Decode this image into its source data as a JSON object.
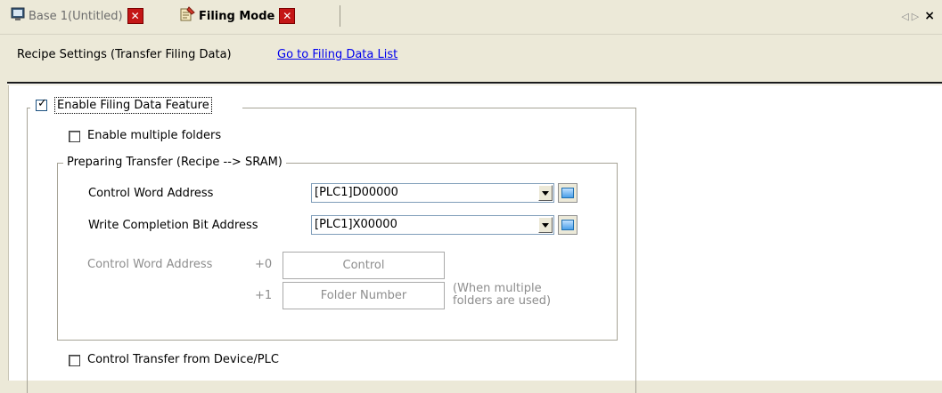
{
  "tabs": [
    {
      "label": "Base 1(Untitled)",
      "active": false,
      "icon": "monitor-icon"
    },
    {
      "label": "Filing Mode",
      "active": true,
      "icon": "filing-icon"
    }
  ],
  "nav": {
    "prev": "◁",
    "next": "▷",
    "close": "×"
  },
  "header": {
    "title": "Recipe Settings (Transfer Filing Data)",
    "link": "Go to Filing Data List"
  },
  "filing": {
    "enable_label": "Enable Filing Data Feature",
    "enable_checked": true,
    "multiple_folders_label": "Enable multiple folders",
    "multiple_folders_checked": false,
    "group_title": "Preparing Transfer (Recipe --> SRAM)",
    "control_word_label": "Control Word Address",
    "control_word_value": "[PLC1]D00000",
    "write_completion_label": "Write Completion Bit Address",
    "write_completion_value": "[PLC1]X00000",
    "table_title": "Control Word Address",
    "rows": [
      {
        "offset": "+0",
        "cell": "Control"
      },
      {
        "offset": "+1",
        "cell": "Folder Number"
      }
    ],
    "note_line1": "(When multiple",
    "note_line2": "folders are used)",
    "control_transfer_label": "Control Transfer from Device/PLC",
    "control_transfer_checked": false
  },
  "colors": {
    "tab_close": "#c41616",
    "link": "#0000ee",
    "background": "#ece9d8"
  }
}
